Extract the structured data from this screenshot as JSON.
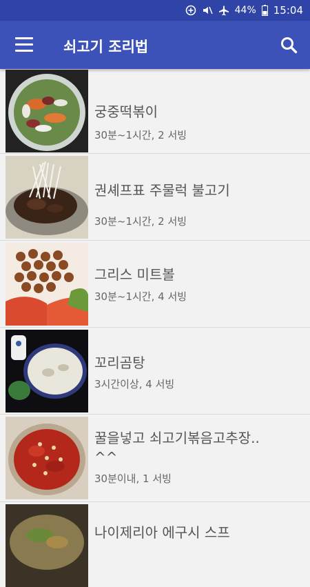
{
  "status_bar": {
    "battery": "44%",
    "time": "15:04"
  },
  "app_bar": {
    "title": "쇠고기 조리법",
    "menu_icon": "hamburger-menu-icon",
    "search_icon": "search-icon"
  },
  "recipes": [
    {
      "title": "궁중떡볶이",
      "meta": "30분~1시간, 2 서빙"
    },
    {
      "title": "권셰프표 주물럭 불고기",
      "meta": "30분~1시간, 2 서빙"
    },
    {
      "title": "그리스 미트볼",
      "meta": "30분~1시간, 4 서빙"
    },
    {
      "title": "꼬리곰탕",
      "meta": "3시간이상, 4 서빙"
    },
    {
      "title": "꿀을넣고 쇠고기볶음고추장..\n^^",
      "meta": "30분이내, 1 서빙"
    },
    {
      "title": "나이제리아 에구시 스프",
      "meta": ""
    }
  ],
  "colors": {
    "status_bar": "#2f44a6",
    "app_bar": "#3c52b8",
    "background": "#f2f2f2"
  }
}
